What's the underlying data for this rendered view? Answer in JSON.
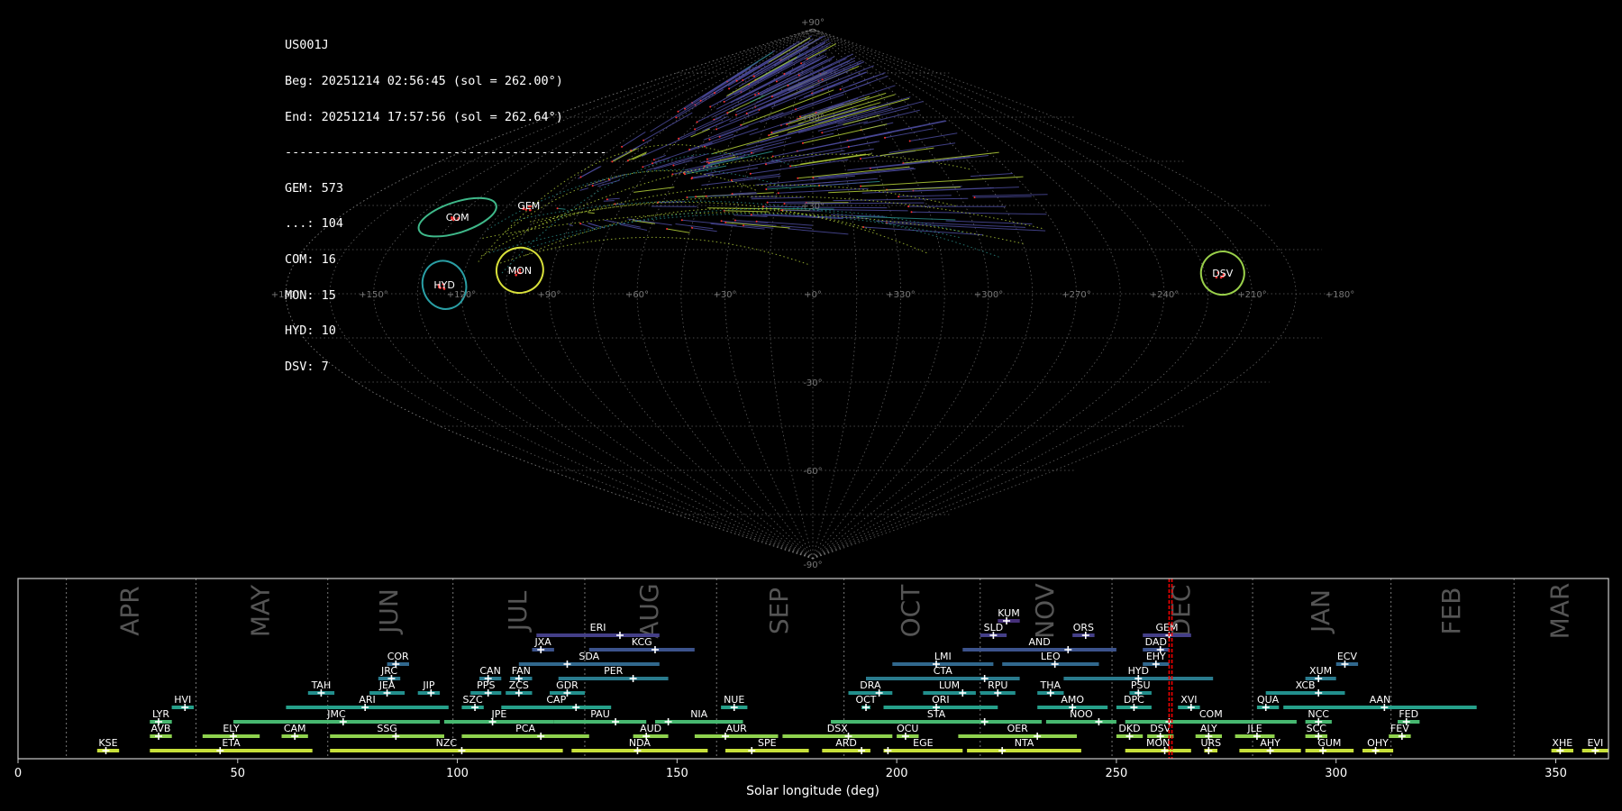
{
  "header": {
    "station": "US001J",
    "beg": "Beg: 20251214 02:56:45 (sol = 262.00°)",
    "end": "End: 20251214 17:57:56 (sol = 262.64°)",
    "separator": "--------------------------------------------",
    "counts": [
      "GEM: 573",
      "...: 104",
      "COM: 16",
      "MON: 15",
      "HYD: 10",
      "DSV: 7"
    ]
  },
  "colors": {
    "background": "#000000",
    "trail_main": "#4b4a9a",
    "trail_green": "#b5d23a",
    "trail_teal": "#2a8f8a",
    "meteor_points": "#ff3030",
    "grid": "#888888"
  },
  "sky_map": {
    "projection": "sinusoidal",
    "lon_labels": [
      "+180°",
      "+150°",
      "+120°",
      "+90°",
      "+60°",
      "+30°",
      "+0°",
      "+330°",
      "+300°",
      "+270°",
      "+240°",
      "+210°",
      "+180°"
    ],
    "lat_labels": [
      "+90°",
      "+60°",
      "+30°",
      "-30°",
      "-60°",
      "-90°"
    ],
    "radiants": [
      {
        "code": "COM",
        "lon": 135,
        "lat": 26,
        "color": "#3fb98a",
        "rx": 45,
        "ry": 17
      },
      {
        "code": "GEM",
        "lon": 112,
        "lat": 30,
        "color": "#ff4040",
        "rx": 0,
        "ry": 0
      },
      {
        "code": "MON",
        "lon": 101,
        "lat": 8,
        "color": "#d8e03a",
        "rx": 26,
        "ry": 25
      },
      {
        "code": "HYD",
        "lon": 126,
        "lat": 3,
        "color": "#2a9fa5",
        "rx": 24,
        "ry": 27
      },
      {
        "code": "DSV",
        "lon": 219,
        "lat": 7,
        "color": "#9ad04a",
        "rx": 24,
        "ry": 24
      }
    ]
  },
  "chart_data": {
    "type": "timeline",
    "xlabel": "Solar longitude (deg)",
    "xlim": [
      0,
      362
    ],
    "x_ticks": [
      0,
      50,
      100,
      150,
      200,
      250,
      300,
      350
    ],
    "current_range": [
      262.0,
      262.64
    ],
    "months": [
      {
        "name": "APR",
        "start": 11
      },
      {
        "name": "MAY",
        "start": 40.5
      },
      {
        "name": "JUN",
        "start": 70.5
      },
      {
        "name": "JUL",
        "start": 99
      },
      {
        "name": "AUG",
        "start": 129
      },
      {
        "name": "SEP",
        "start": 159
      },
      {
        "name": "OCT",
        "start": 188
      },
      {
        "name": "NOV",
        "start": 219
      },
      {
        "name": "DEC",
        "start": 249
      },
      {
        "name": "JAN",
        "start": 281
      },
      {
        "name": "FEB",
        "start": 312.5
      },
      {
        "name": "MAR",
        "start": 340.5
      }
    ],
    "showers": [
      {
        "code": "KUM",
        "start": 223,
        "end": 228,
        "peak": 225,
        "row": 11
      },
      {
        "code": "ERI",
        "start": 118,
        "end": 146,
        "peak": 137,
        "row": 10
      },
      {
        "code": "SLD",
        "start": 219,
        "end": 225,
        "peak": 222,
        "row": 10
      },
      {
        "code": "ORS",
        "start": 240,
        "end": 245,
        "peak": 243,
        "row": 10
      },
      {
        "code": "GEM",
        "start": 256,
        "end": 267,
        "peak": 262,
        "row": 10
      },
      {
        "code": "JXA",
        "start": 117,
        "end": 122,
        "peak": 119,
        "row": 9
      },
      {
        "code": "KCG",
        "start": 130,
        "end": 154,
        "peak": 145,
        "row": 9
      },
      {
        "code": "AND",
        "start": 215,
        "end": 250,
        "peak": 239,
        "row": 9
      },
      {
        "code": "DAD",
        "start": 256,
        "end": 262,
        "peak": 260,
        "row": 9
      },
      {
        "code": "COR",
        "start": 84,
        "end": 89,
        "peak": 86,
        "row": 8
      },
      {
        "code": "SDA",
        "start": 114,
        "end": 146,
        "peak": 125,
        "row": 8
      },
      {
        "code": "LMI",
        "start": 199,
        "end": 222,
        "peak": 209,
        "row": 8
      },
      {
        "code": "LEO",
        "start": 224,
        "end": 246,
        "peak": 236,
        "row": 8
      },
      {
        "code": "EHY",
        "start": 256,
        "end": 262,
        "peak": 259,
        "row": 8
      },
      {
        "code": "ECV",
        "start": 300,
        "end": 305,
        "peak": 302,
        "row": 8
      },
      {
        "code": "JRC",
        "start": 82,
        "end": 87,
        "peak": 85,
        "row": 7
      },
      {
        "code": "CAN",
        "start": 105,
        "end": 110,
        "peak": 107,
        "row": 7
      },
      {
        "code": "FAN",
        "start": 112,
        "end": 117,
        "peak": 114,
        "row": 7
      },
      {
        "code": "PER",
        "start": 123,
        "end": 148,
        "peak": 140,
        "row": 7
      },
      {
        "code": "CTA",
        "start": 193,
        "end": 228,
        "peak": 220,
        "row": 7
      },
      {
        "code": "HYD",
        "start": 238,
        "end": 272,
        "peak": 255,
        "row": 7
      },
      {
        "code": "XUM",
        "start": 293,
        "end": 300,
        "peak": 296,
        "row": 7
      },
      {
        "code": "TAH",
        "start": 66,
        "end": 72,
        "peak": 69,
        "row": 6
      },
      {
        "code": "JEA",
        "start": 80,
        "end": 88,
        "peak": 84,
        "row": 6
      },
      {
        "code": "JIP",
        "start": 91,
        "end": 96,
        "peak": 94,
        "row": 6
      },
      {
        "code": "PPS",
        "start": 103,
        "end": 110,
        "peak": 107,
        "row": 6
      },
      {
        "code": "ZCS",
        "start": 111,
        "end": 117,
        "peak": 114,
        "row": 6
      },
      {
        "code": "GDR",
        "start": 121,
        "end": 129,
        "peak": 125,
        "row": 6
      },
      {
        "code": "DRA",
        "start": 189,
        "end": 199,
        "peak": 196,
        "row": 6
      },
      {
        "code": "LUM",
        "start": 206,
        "end": 218,
        "peak": 215,
        "row": 6
      },
      {
        "code": "RPU",
        "start": 219,
        "end": 227,
        "peak": 223,
        "row": 6
      },
      {
        "code": "THA",
        "start": 232,
        "end": 238,
        "peak": 235,
        "row": 6
      },
      {
        "code": "PSU",
        "start": 253,
        "end": 258,
        "peak": 255,
        "row": 6
      },
      {
        "code": "XCB",
        "start": 284,
        "end": 302,
        "peak": 296,
        "row": 6
      },
      {
        "code": "HVI",
        "start": 35,
        "end": 40,
        "peak": 38,
        "row": 5
      },
      {
        "code": "ARI",
        "start": 61,
        "end": 98,
        "peak": 79,
        "row": 5
      },
      {
        "code": "SZC",
        "start": 101,
        "end": 106,
        "peak": 104,
        "row": 5
      },
      {
        "code": "CAP",
        "start": 110,
        "end": 135,
        "peak": 127,
        "row": 5
      },
      {
        "code": "NUE",
        "start": 160,
        "end": 166,
        "peak": 163,
        "row": 5
      },
      {
        "code": "OCT",
        "start": 192,
        "end": 194,
        "peak": 193,
        "row": 5
      },
      {
        "code": "ORI",
        "start": 197,
        "end": 223,
        "peak": 209,
        "row": 5
      },
      {
        "code": "AMO",
        "start": 232,
        "end": 248,
        "peak": 240,
        "row": 5
      },
      {
        "code": "DPC",
        "start": 250,
        "end": 258,
        "peak": 254,
        "row": 5
      },
      {
        "code": "XVI",
        "start": 264,
        "end": 269,
        "peak": 267,
        "row": 5
      },
      {
        "code": "QUA",
        "start": 282,
        "end": 287,
        "peak": 284,
        "row": 5
      },
      {
        "code": "AAN",
        "start": 288,
        "end": 332,
        "peak": 311,
        "row": 5
      },
      {
        "code": "LYR",
        "start": 30,
        "end": 35,
        "peak": 32,
        "row": 4
      },
      {
        "code": "JMC",
        "start": 49,
        "end": 96,
        "peak": 74,
        "row": 4
      },
      {
        "code": "JPE",
        "start": 97,
        "end": 122,
        "peak": 108,
        "row": 4
      },
      {
        "code": "PAU",
        "start": 122,
        "end": 143,
        "peak": 136,
        "row": 4
      },
      {
        "code": "NIA",
        "start": 145,
        "end": 165,
        "peak": 148,
        "row": 4
      },
      {
        "code": "STA",
        "start": 185,
        "end": 233,
        "peak": 220,
        "row": 4
      },
      {
        "code": "NOO",
        "start": 234,
        "end": 250,
        "peak": 246,
        "row": 4
      },
      {
        "code": "COM",
        "start": 252,
        "end": 291,
        "peak": 262,
        "row": 4
      },
      {
        "code": "NCC",
        "start": 293,
        "end": 299,
        "peak": 296,
        "row": 4
      },
      {
        "code": "FED",
        "start": 314,
        "end": 319,
        "peak": 316,
        "row": 4
      },
      {
        "code": "AVB",
        "start": 30,
        "end": 35,
        "peak": 32,
        "row": 3
      },
      {
        "code": "ELY",
        "start": 42,
        "end": 55,
        "peak": 49,
        "row": 3
      },
      {
        "code": "CAM",
        "start": 60,
        "end": 66,
        "peak": 63,
        "row": 3
      },
      {
        "code": "SSG",
        "start": 71,
        "end": 97,
        "peak": 86,
        "row": 3
      },
      {
        "code": "PCA",
        "start": 101,
        "end": 130,
        "peak": 119,
        "row": 3
      },
      {
        "code": "AUD",
        "start": 140,
        "end": 148,
        "peak": 143,
        "row": 3
      },
      {
        "code": "AUR",
        "start": 154,
        "end": 173,
        "peak": 161,
        "row": 3
      },
      {
        "code": "DSX",
        "start": 174,
        "end": 199,
        "peak": 189,
        "row": 3
      },
      {
        "code": "OCU",
        "start": 200,
        "end": 205,
        "peak": 202,
        "row": 3
      },
      {
        "code": "OER",
        "start": 214,
        "end": 241,
        "peak": 232,
        "row": 3
      },
      {
        "code": "DKD",
        "start": 250,
        "end": 256,
        "peak": 253,
        "row": 3
      },
      {
        "code": "DSV",
        "start": 257,
        "end": 263,
        "peak": 260,
        "row": 3
      },
      {
        "code": "ALY",
        "start": 268,
        "end": 274,
        "peak": 271,
        "row": 3
      },
      {
        "code": "JLE",
        "start": 277,
        "end": 286,
        "peak": 282,
        "row": 3
      },
      {
        "code": "SCC",
        "start": 293,
        "end": 298,
        "peak": 296,
        "row": 3
      },
      {
        "code": "FEV",
        "start": 312,
        "end": 317,
        "peak": 315,
        "row": 3
      },
      {
        "code": "KSE",
        "start": 18,
        "end": 23,
        "peak": 20,
        "row": 2
      },
      {
        "code": "ETA",
        "start": 30,
        "end": 67,
        "peak": 46,
        "row": 2
      },
      {
        "code": "NZC",
        "start": 71,
        "end": 124,
        "peak": 101,
        "row": 2
      },
      {
        "code": "NDA",
        "start": 126,
        "end": 157,
        "peak": 141,
        "row": 2
      },
      {
        "code": "SPE",
        "start": 161,
        "end": 180,
        "peak": 167,
        "row": 2
      },
      {
        "code": "ARD",
        "start": 183,
        "end": 194,
        "peak": 192,
        "row": 2
      },
      {
        "code": "EGE",
        "start": 197,
        "end": 215,
        "peak": 198,
        "row": 2
      },
      {
        "code": "NTA",
        "start": 216,
        "end": 242,
        "peak": 224,
        "row": 2
      },
      {
        "code": "MON",
        "start": 252,
        "end": 267,
        "peak": 261,
        "row": 2
      },
      {
        "code": "URS",
        "start": 270,
        "end": 273,
        "peak": 271,
        "row": 2
      },
      {
        "code": "AHY",
        "start": 278,
        "end": 292,
        "peak": 285,
        "row": 2
      },
      {
        "code": "GUM",
        "start": 293,
        "end": 304,
        "peak": 297,
        "row": 2
      },
      {
        "code": "OHY",
        "start": 306,
        "end": 313,
        "peak": 309,
        "row": 2
      },
      {
        "code": "XHE",
        "start": 349,
        "end": 354,
        "peak": 351,
        "row": 2
      },
      {
        "code": "EVI",
        "start": 356,
        "end": 362,
        "peak": 359,
        "row": 2
      }
    ]
  }
}
